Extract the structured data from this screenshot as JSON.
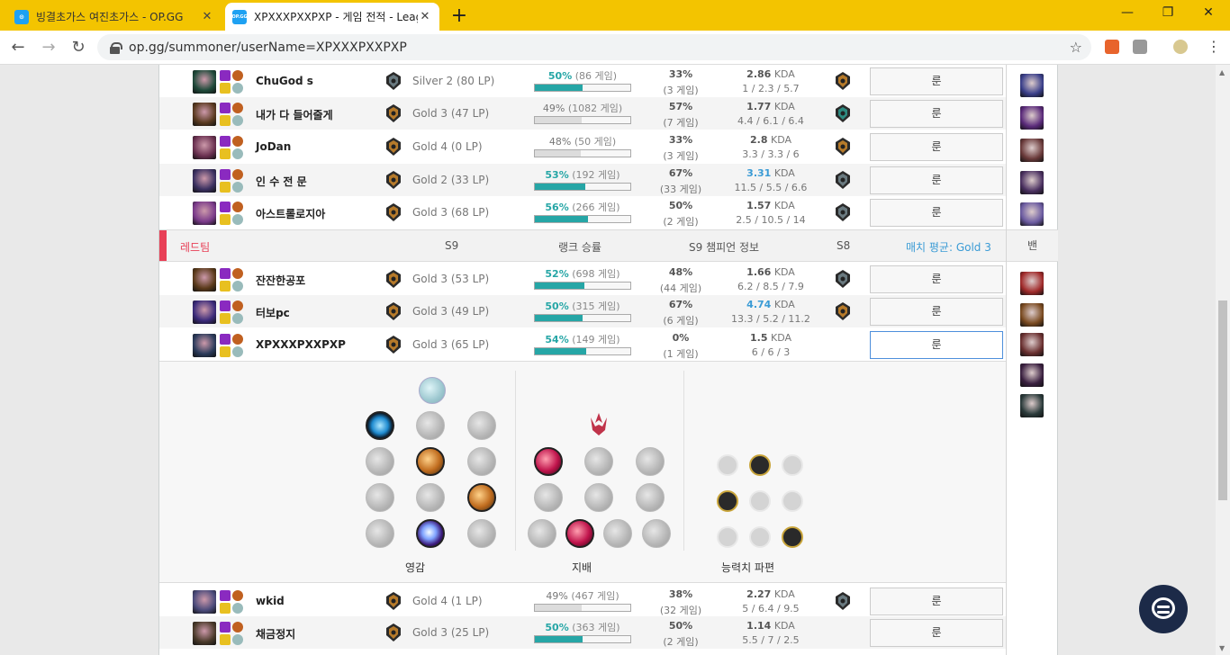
{
  "browser": {
    "tabs": [
      {
        "title": "빙결초가스 여진초가스 - OP.GG",
        "favicon": "opgg-icon",
        "active": false
      },
      {
        "title": "XPXXXPXXPXP - 게임 전적 - League",
        "favicon": "opgg-icon",
        "active": true
      }
    ],
    "url": "op.gg/summoner/userName=XPXXXPXXPXP",
    "favicon_text": "OP.GG"
  },
  "blue_team": [
    {
      "name": "ChuGod s",
      "tier": "Silver 2 (80 LP)",
      "winrate_pct": "50%",
      "winrate_games": "(86 게임)",
      "winrate": 0.5,
      "highlight": true,
      "champ_wr": "33%",
      "champ_games": "(3 게임)",
      "kda": "2.86",
      "kda_unit": "KDA",
      "kda_detail": "1 / 2.3 / 5.7",
      "rune_label": "룬",
      "champ_color": "#1f4a3a",
      "tier_type": "silver",
      "s8": "gold"
    },
    {
      "name": "내가 다 들어줄게",
      "tier": "Gold 3 (47 LP)",
      "winrate_pct": "49%",
      "winrate_games": "(1082 게임)",
      "winrate": 0.49,
      "highlight": false,
      "champ_wr": "57%",
      "champ_games": "(7 게임)",
      "kda": "1.77",
      "kda_unit": "KDA",
      "kda_detail": "4.4 / 6.1 / 6.4",
      "rune_label": "룬",
      "champ_color": "#5a3a20",
      "tier_type": "gold",
      "s8": "plat"
    },
    {
      "name": "JoDan",
      "tier": "Gold 4 (0 LP)",
      "winrate_pct": "48%",
      "winrate_games": "(50 게임)",
      "winrate": 0.48,
      "highlight": false,
      "champ_wr": "33%",
      "champ_games": "(3 게임)",
      "kda": "2.8",
      "kda_unit": "KDA",
      "kda_detail": "3.3 / 3.3 / 6",
      "rune_label": "룬",
      "champ_color": "#6a3050",
      "tier_type": "gold",
      "s8": "gold"
    },
    {
      "name": "인 수 전 문",
      "tier": "Gold 2 (33 LP)",
      "winrate_pct": "53%",
      "winrate_games": "(192 게임)",
      "winrate": 0.53,
      "highlight": true,
      "champ_wr": "67%",
      "champ_games": "(33 게임)",
      "kda": "3.31",
      "kda_unit": "KDA",
      "kda_detail": "11.5 / 5.5 / 6.6",
      "rune_label": "룬",
      "champ_color": "#3a3060",
      "tier_type": "gold",
      "s8": "silver",
      "kda_blue": true
    },
    {
      "name": "아스트롤로지아",
      "tier": "Gold 3 (68 LP)",
      "winrate_pct": "56%",
      "winrate_games": "(266 게임)",
      "winrate": 0.56,
      "highlight": true,
      "champ_wr": "50%",
      "champ_games": "(2 게임)",
      "kda": "1.57",
      "kda_unit": "KDA",
      "kda_detail": "2.5 / 10.5 / 14",
      "rune_label": "룬",
      "champ_color": "#7a3a8a",
      "tier_type": "gold",
      "s8": "silver"
    }
  ],
  "red_header": {
    "team": "레드팀",
    "s9": "S9",
    "rank_wr": "랭크 승률",
    "champ_info": "S9 챔피언 정보",
    "s8": "S8",
    "match_avg": "매치 평균: Gold 3",
    "bans": "밴"
  },
  "red_team": [
    {
      "name": "잔잔한공포",
      "tier": "Gold 3 (53 LP)",
      "winrate_pct": "52%",
      "winrate_games": "(698 게임)",
      "winrate": 0.52,
      "highlight": true,
      "champ_wr": "48%",
      "champ_games": "(44 게임)",
      "kda": "1.66",
      "kda_unit": "KDA",
      "kda_detail": "6.2 / 8.5 / 7.9",
      "rune_label": "룬",
      "champ_color": "#5a3a1a",
      "tier_type": "gold",
      "s8": "silver"
    },
    {
      "name": "터보pc",
      "tier": "Gold 3 (49 LP)",
      "winrate_pct": "50%",
      "winrate_games": "(315 게임)",
      "winrate": 0.5,
      "highlight": true,
      "champ_wr": "67%",
      "champ_games": "(6 게임)",
      "kda": "4.74",
      "kda_unit": "KDA",
      "kda_detail": "13.3 / 5.2 / 11.2",
      "rune_label": "룬",
      "champ_color": "#3a2a7a",
      "tier_type": "gold",
      "s8": "gold",
      "kda_blue": true
    },
    {
      "name": "XPXXXPXXPXP",
      "tier": "Gold 3 (65 LP)",
      "winrate_pct": "54%",
      "winrate_games": "(149 게임)",
      "winrate": 0.54,
      "highlight": true,
      "champ_wr": "0%",
      "champ_games": "(1 게임)",
      "kda": "1.5",
      "kda_unit": "KDA",
      "kda_detail": "6 / 6 / 3",
      "rune_label": "룬",
      "champ_color": "#2a3a5a",
      "tier_type": "gold",
      "s8": "",
      "active": true
    }
  ],
  "rune_page": {
    "tree1_label": "영감",
    "tree2_label": "지배",
    "tree3_label": "능력치 파편"
  },
  "more_players": [
    {
      "name": "wkid",
      "tier": "Gold 4 (1 LP)",
      "winrate_pct": "49%",
      "winrate_games": "(467 게임)",
      "winrate": 0.49,
      "highlight": false,
      "champ_wr": "38%",
      "champ_games": "(32 게임)",
      "kda": "2.27",
      "kda_unit": "KDA",
      "kda_detail": "5 / 6.4 / 9.5",
      "rune_label": "룬",
      "champ_color": "#4a4a7a",
      "tier_type": "gold",
      "s8": "silver"
    },
    {
      "name": "채금정지",
      "tier": "Gold 3 (25 LP)",
      "winrate_pct": "50%",
      "winrate_games": "(363 게임)",
      "winrate": 0.5,
      "highlight": true,
      "champ_wr": "50%",
      "champ_games": "(2 게임)",
      "kda": "1.14",
      "kda_unit": "KDA",
      "kda_detail": "5.5 / 7 / 2.5",
      "rune_label": "룬",
      "champ_color": "#4a3a2a",
      "tier_type": "gold",
      "s8": ""
    }
  ],
  "bans_blue": [
    "#3a3f8a",
    "#5a2a7a",
    "#6a3a3a",
    "#4a3060",
    "#6a5aa0"
  ],
  "bans_red": [
    "#a02a2a",
    "#7a4a20",
    "#6a3030",
    "#3a2040",
    "#2a3a3a"
  ],
  "colors": {
    "accent": "#26a6a6",
    "red_team": "#e84057",
    "blue_text": "#3a9bd5",
    "chrome": "#f3c400"
  }
}
